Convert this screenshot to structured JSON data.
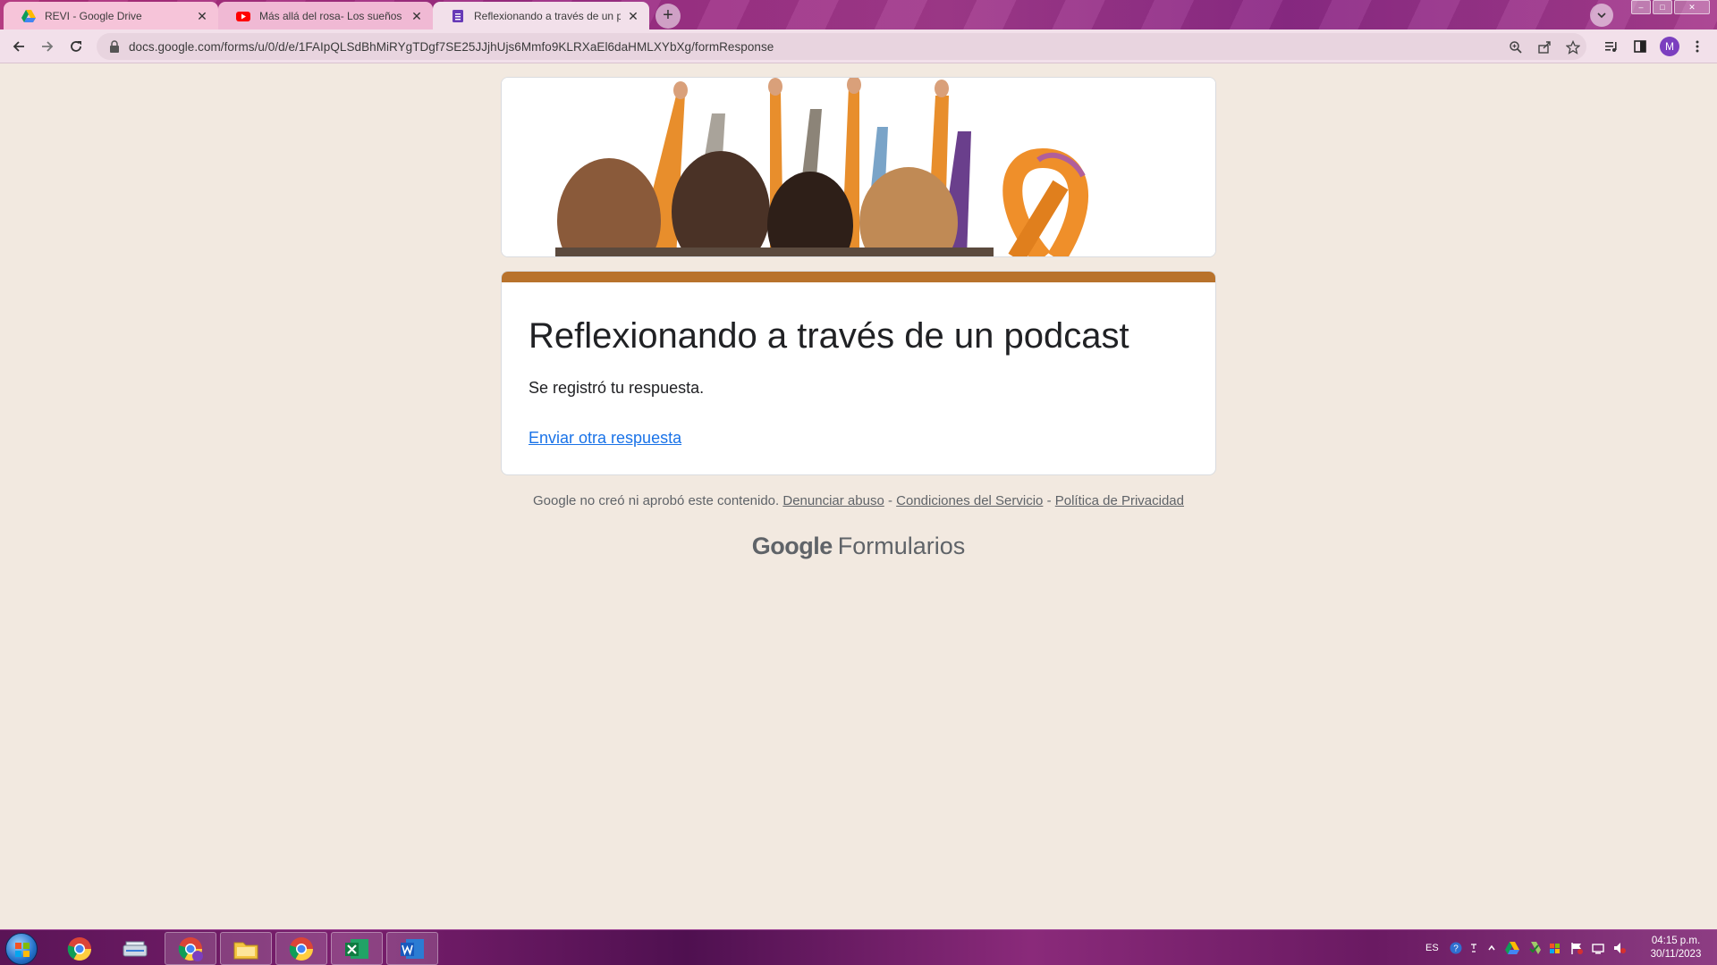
{
  "browser": {
    "tabs": [
      {
        "title": "REVI - Google Drive",
        "icon": "google-drive-icon"
      },
      {
        "title": "Más allá del rosa- Los sueños de",
        "icon": "youtube-icon"
      },
      {
        "title": "Reflexionando a través de un podcast",
        "icon": "google-forms-icon",
        "active": true
      }
    ],
    "url": "docs.google.com/forms/u/0/d/e/1FAIpQLSdBhMiRYgTDgf7SE25JJjhUjs6Mmfo9KLRXaEl6daHMLXYbXg/formResponse",
    "profile_initial": "M"
  },
  "form": {
    "title": "Reflexionando a través de un podcast",
    "message": "Se registró tu respuesta.",
    "link": "Enviar otra respuesta",
    "accent_color": "#b8722c"
  },
  "footer": {
    "notice": "Google no creó ni aprobó este contenido.",
    "sep": " - ",
    "links": [
      "Denunciar abuso",
      "Condiciones del Servicio",
      "Política de Privacidad"
    ],
    "brand_google": "Google",
    "brand_product": "Formularios"
  },
  "taskbar": {
    "language": "ES",
    "time": "04:15 p.m.",
    "date": "30/11/2023",
    "apps": [
      "chrome-icon",
      "scanner-icon",
      "chrome-profile-icon",
      "file-explorer-icon",
      "chrome-icon",
      "excel-icon",
      "word-icon"
    ]
  }
}
